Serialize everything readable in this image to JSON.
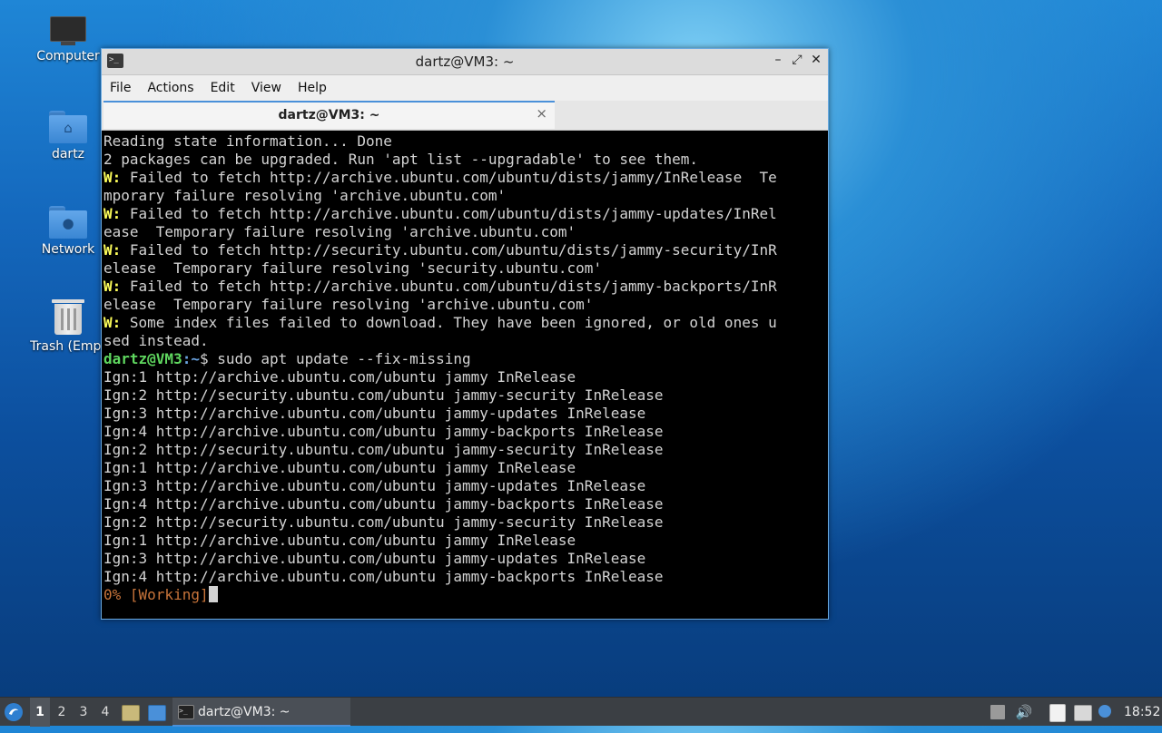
{
  "desktop": {
    "icons": [
      {
        "label": "Computer",
        "icon": "computer-icon"
      },
      {
        "label": "dartz",
        "icon": "home-folder-icon"
      },
      {
        "label": "Network",
        "icon": "network-folder-icon"
      },
      {
        "label": "Trash (Empt",
        "icon": "trash-icon"
      }
    ]
  },
  "window": {
    "title": "dartz@VM3: ~",
    "menu": [
      "File",
      "Actions",
      "Edit",
      "View",
      "Help"
    ],
    "tab_title": "dartz@VM3: ~",
    "controls": {
      "minimize": "–",
      "maximize": "⤢",
      "close": "✕"
    }
  },
  "terminal": {
    "prompt_user": "dartz@VM3",
    "prompt_path": ":~",
    "prompt_sign": "$",
    "command": " sudo apt update --fix-missing",
    "lines_before": [
      {
        "prefix": "",
        "text": "Reading state information... Done"
      },
      {
        "prefix": "",
        "text": "2 packages can be upgraded. Run 'apt list --upgradable' to see them."
      },
      {
        "prefix": "W:",
        "text": " Failed to fetch http://archive.ubuntu.com/ubuntu/dists/jammy/InRelease  Te"
      },
      {
        "prefix": "",
        "text": "mporary failure resolving 'archive.ubuntu.com'"
      },
      {
        "prefix": "W:",
        "text": " Failed to fetch http://archive.ubuntu.com/ubuntu/dists/jammy-updates/InRel"
      },
      {
        "prefix": "",
        "text": "ease  Temporary failure resolving 'archive.ubuntu.com'"
      },
      {
        "prefix": "W:",
        "text": " Failed to fetch http://security.ubuntu.com/ubuntu/dists/jammy-security/InR"
      },
      {
        "prefix": "",
        "text": "elease  Temporary failure resolving 'security.ubuntu.com'"
      },
      {
        "prefix": "W:",
        "text": " Failed to fetch http://archive.ubuntu.com/ubuntu/dists/jammy-backports/InR"
      },
      {
        "prefix": "",
        "text": "elease  Temporary failure resolving 'archive.ubuntu.com'"
      },
      {
        "prefix": "W:",
        "text": " Some index files failed to download. They have been ignored, or old ones u"
      },
      {
        "prefix": "",
        "text": "sed instead."
      }
    ],
    "lines_after": [
      "Ign:1 http://archive.ubuntu.com/ubuntu jammy InRelease",
      "Ign:2 http://security.ubuntu.com/ubuntu jammy-security InRelease",
      "Ign:3 http://archive.ubuntu.com/ubuntu jammy-updates InRelease",
      "Ign:4 http://archive.ubuntu.com/ubuntu jammy-backports InRelease",
      "Ign:2 http://security.ubuntu.com/ubuntu jammy-security InRelease",
      "Ign:1 http://archive.ubuntu.com/ubuntu jammy InRelease",
      "Ign:3 http://archive.ubuntu.com/ubuntu jammy-updates InRelease",
      "Ign:4 http://archive.ubuntu.com/ubuntu jammy-backports InRelease",
      "Ign:2 http://security.ubuntu.com/ubuntu jammy-security InRelease",
      "Ign:1 http://archive.ubuntu.com/ubuntu jammy InRelease",
      "Ign:3 http://archive.ubuntu.com/ubuntu jammy-updates InRelease",
      "Ign:4 http://archive.ubuntu.com/ubuntu jammy-backports InRelease"
    ],
    "progress_line": "0% [Working]"
  },
  "taskbar": {
    "workspaces": [
      "1",
      "2",
      "3",
      "4"
    ],
    "active_workspace": "1",
    "task_label": "dartz@VM3: ~",
    "clock": "18:52"
  },
  "colors": {
    "warning": "#ffff5b",
    "prompt_user": "#5fd75f",
    "prompt_path": "#6aa3e0",
    "progress": "#c8743a",
    "accent": "#4a90d9"
  }
}
